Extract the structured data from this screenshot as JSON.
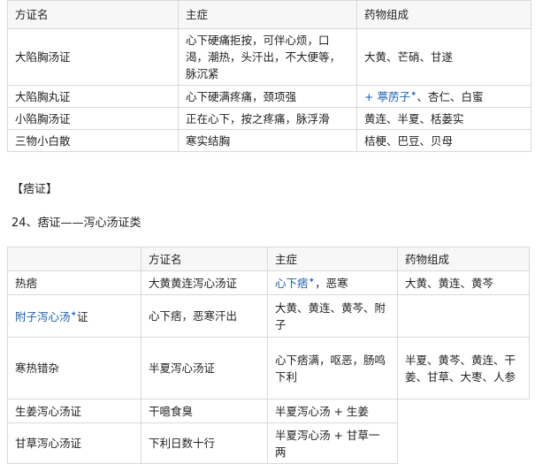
{
  "table1": {
    "headers": [
      "方证名",
      "主症",
      "药物组成"
    ],
    "rows": [
      {
        "name": "大陷胸汤证",
        "symptom": "心下硬痛拒按，可伴心烦，口渴，潮热，头汗出，不大便等，脉沉紧",
        "herbs": "大黄、芒硝、甘遂"
      },
      {
        "name": "大陷胸丸证",
        "symptom": "心下硬满疼痛，颈项强",
        "herbs_prefix": "+ ",
        "herbs_link": "葶苈子",
        "herbs_rest": "、杏仁、白蜜"
      },
      {
        "name": "小陷胸汤证",
        "symptom": "正在心下，按之疼痛，脉浮滑",
        "herbs": "黄连、半夏、栝蒌实"
      },
      {
        "name": "三物小白散",
        "symptom": "寒实结胸",
        "herbs": "桔梗、巴豆、贝母"
      }
    ]
  },
  "section_tag": "【痞证】",
  "section_title": "24、痞证——泻心汤证类",
  "table2": {
    "headers": [
      "",
      "方证名",
      "主症",
      "药物组成"
    ],
    "rows": [
      {
        "cat": "热痞",
        "name": "大黄黄连泻心汤证",
        "symptom_link": "心下痞",
        "symptom_rest": "，恶寒",
        "herbs": "大黄、黄连、黄芩"
      },
      {
        "cat_link": "附子泻心汤",
        "cat_rest": "证",
        "name": "心下痞，恶寒汗出",
        "symptom": "大黄、黄连、黄芩、附子",
        "herbs": ""
      },
      {
        "cat": "寒热错杂",
        "name": "半夏泻心汤证",
        "symptom": "心下痞满，呕恶，肠鸣下利",
        "herbs": "半夏、黄芩、黄连、干姜、甘草、大枣、人参"
      },
      {
        "cat": "生姜泻心汤证",
        "name": "干噫食臭",
        "symptom": "半夏泻心汤 + 生姜"
      },
      {
        "cat": "甘草泻心汤证",
        "name": "下利日数十行",
        "symptom": "半夏泻心汤 + 甘草一两"
      }
    ]
  },
  "link_plus": "✦",
  "colors": {
    "link": "#1f5fa8",
    "border": "#d9d9d9",
    "header_bg": "#f7f7f7"
  }
}
